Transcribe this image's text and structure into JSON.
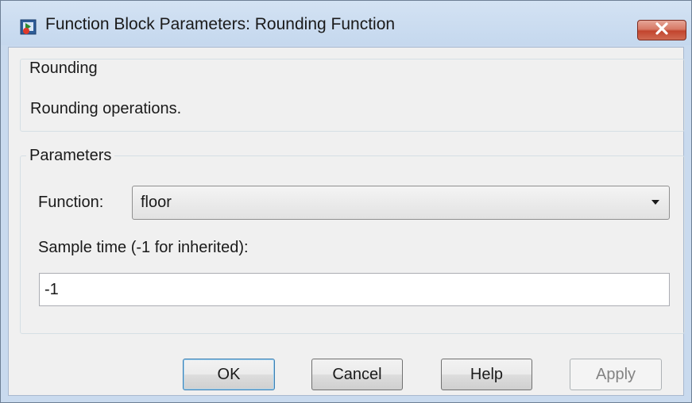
{
  "window": {
    "title": "Function Block Parameters: Rounding Function",
    "icon": "simulink-block-icon",
    "close_icon": "close-icon"
  },
  "rounding_group": {
    "legend": "Rounding",
    "description": "Rounding operations."
  },
  "parameters_group": {
    "legend": "Parameters",
    "function_label": "Function:",
    "function_value": "floor",
    "sample_time_label": "Sample time (-1 for inherited):",
    "sample_time_value": "-1"
  },
  "buttons": {
    "ok": "OK",
    "cancel": "Cancel",
    "help": "Help",
    "apply": "Apply"
  },
  "colors": {
    "titlebar": "#c9daee",
    "close_button": "#c2452e",
    "dialog_background": "#f0f0f0",
    "default_button_border": "#3c7fb1",
    "disabled_text": "#838383"
  }
}
